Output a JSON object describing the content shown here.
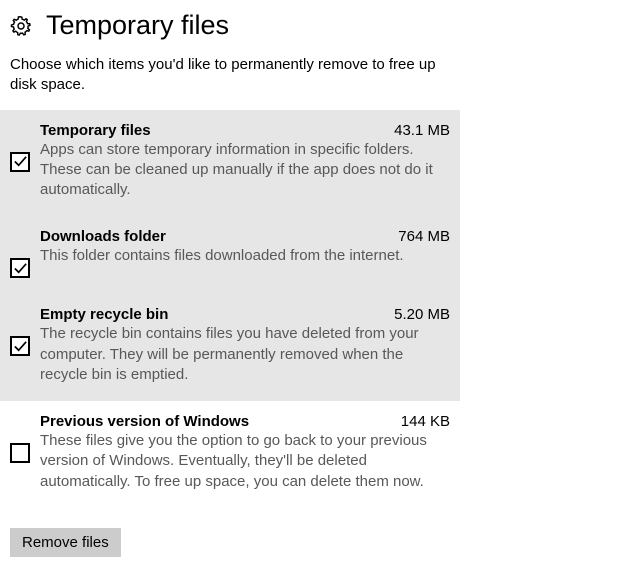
{
  "page": {
    "title": "Temporary files",
    "description": "Choose which items you'd like to permanently remove to free up disk space."
  },
  "items": [
    {
      "title": "Temporary files",
      "size": "43.1 MB",
      "description": "Apps can store temporary information in specific folders. These can be cleaned up manually if the app does not do it automatically.",
      "checked": true
    },
    {
      "title": "Downloads folder",
      "size": "764 MB",
      "description": "This folder contains files downloaded from the internet.",
      "checked": true
    },
    {
      "title": "Empty recycle bin",
      "size": "5.20 MB",
      "description": "The recycle bin contains files you have deleted from your computer. They will be permanently removed when the recycle bin is emptied.",
      "checked": true
    },
    {
      "title": "Previous version of Windows",
      "size": "144 KB",
      "description": "These files give you the option to go back to your previous version of Windows. Eventually, they'll be deleted automatically. To free up space, you can delete them now.",
      "checked": false
    }
  ],
  "actions": {
    "remove_label": "Remove files"
  }
}
